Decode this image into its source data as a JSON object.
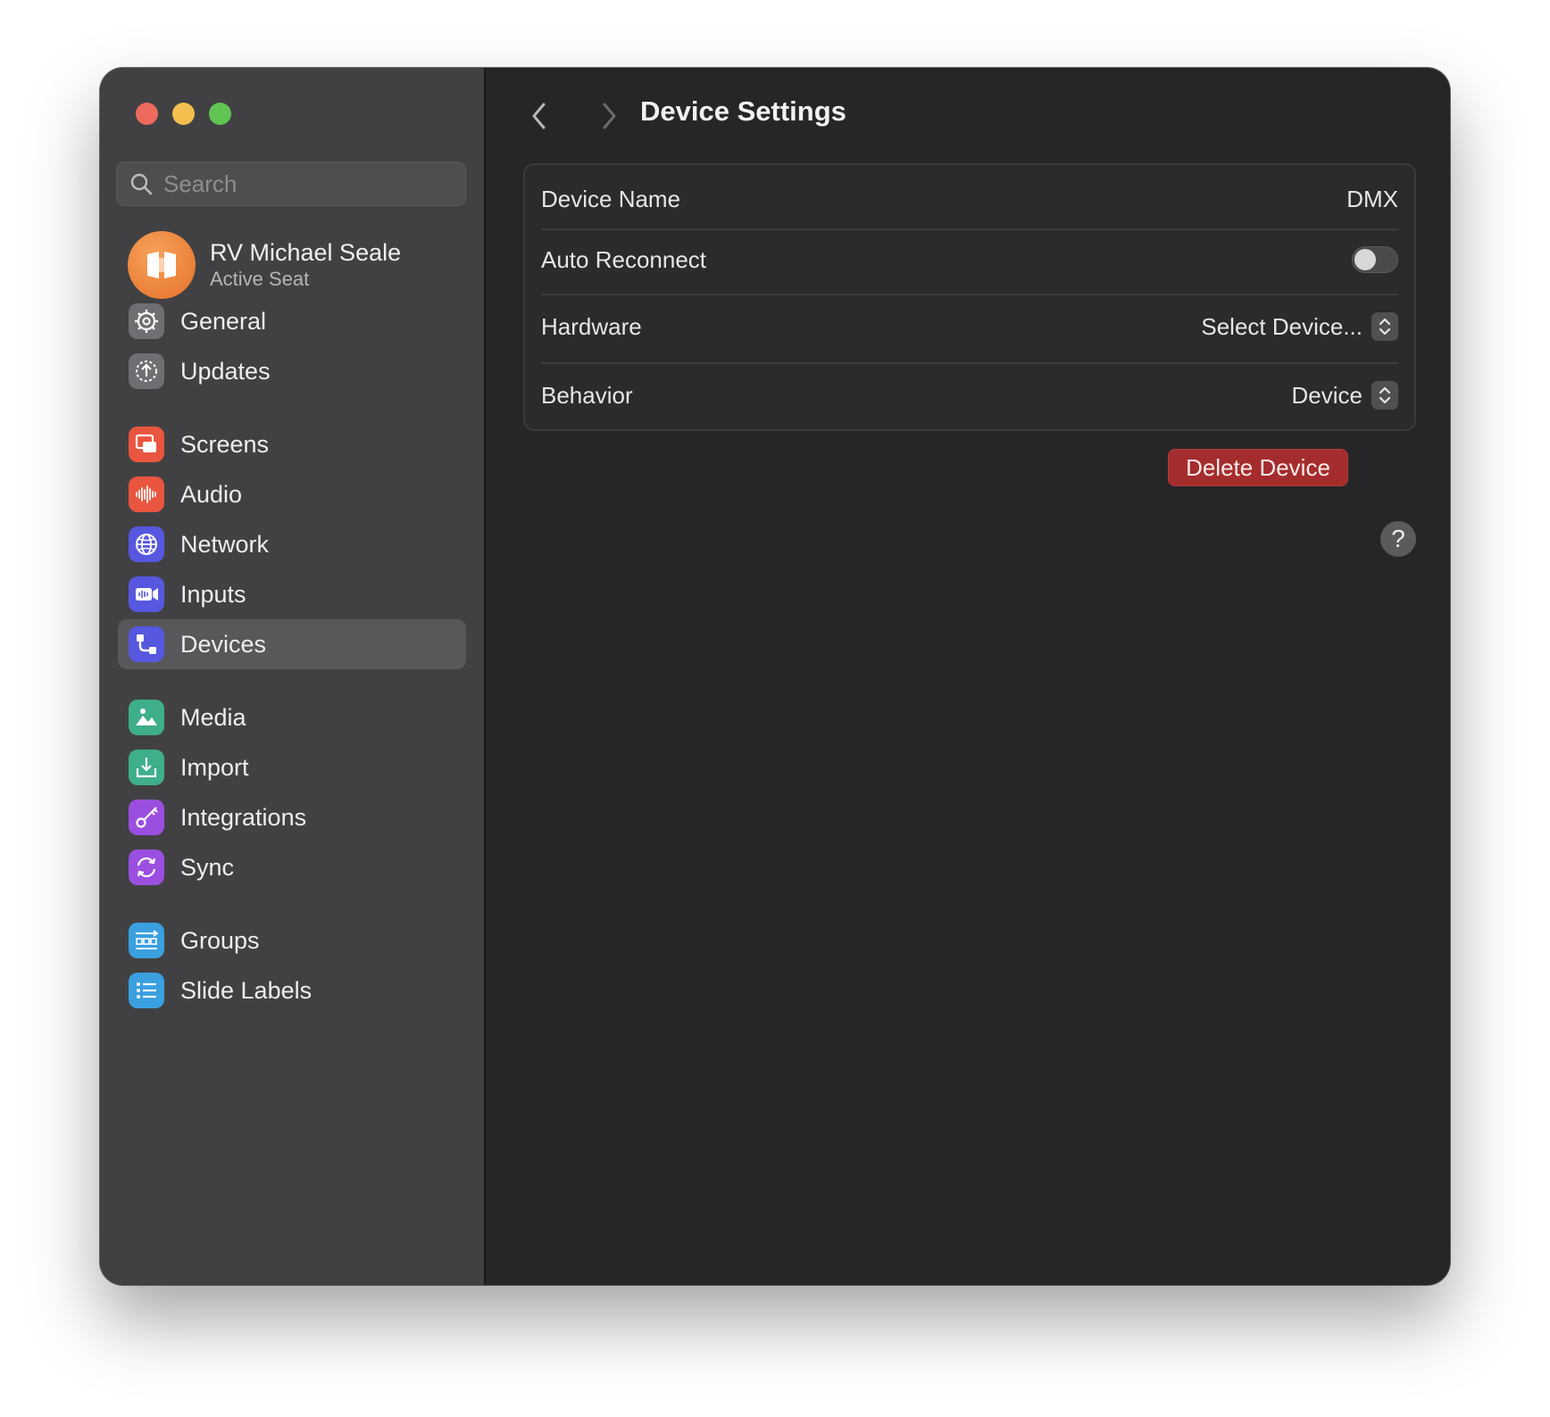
{
  "window": {
    "title": "Device Settings"
  },
  "sidebar": {
    "search_placeholder": "Search",
    "account": {
      "name": "RV Michael Seale",
      "subtitle": "Active Seat"
    },
    "items": [
      {
        "label": "General",
        "icon": "gear-icon",
        "color": "#7a7a7e"
      },
      {
        "label": "Updates",
        "icon": "upload-arrow-icon",
        "color": "#7a7a7e"
      },
      {
        "label": "Screens",
        "icon": "screens-icon",
        "color": "#e9553f"
      },
      {
        "label": "Audio",
        "icon": "waveform-icon",
        "color": "#e9553f"
      },
      {
        "label": "Network",
        "icon": "globe-icon",
        "color": "#5757e0"
      },
      {
        "label": "Inputs",
        "icon": "video-input-icon",
        "color": "#5757e0"
      },
      {
        "label": "Devices",
        "icon": "devices-icon",
        "color": "#5757e0",
        "active": true
      },
      {
        "label": "Media",
        "icon": "image-icon",
        "color": "#3fae8a"
      },
      {
        "label": "Import",
        "icon": "import-icon",
        "color": "#3fae8a"
      },
      {
        "label": "Integrations",
        "icon": "key-icon",
        "color": "#9b4fe0"
      },
      {
        "label": "Sync",
        "icon": "sync-icon",
        "color": "#9b4fe0"
      },
      {
        "label": "Groups",
        "icon": "groups-icon",
        "color": "#3aa0e0"
      },
      {
        "label": "Slide Labels",
        "icon": "list-icon",
        "color": "#3aa0e0"
      }
    ]
  },
  "main": {
    "title": "Device Settings",
    "rows": {
      "device_name": {
        "label": "Device Name",
        "value": "DMX"
      },
      "auto_reconnect": {
        "label": "Auto Reconnect",
        "on": false
      },
      "hardware": {
        "label": "Hardware",
        "value": "Select Device..."
      },
      "behavior": {
        "label": "Behavior",
        "value": "Device"
      }
    },
    "delete_label": "Delete Device",
    "help_label": "?"
  },
  "colors": {
    "accent_delete": "#a52c2c",
    "sidebar_bg": "#414143",
    "main_bg": "#262628"
  }
}
